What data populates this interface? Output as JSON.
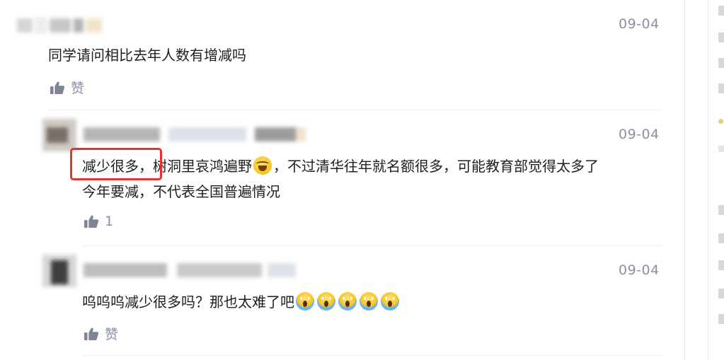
{
  "comments": [
    {
      "date": "09-04",
      "text": "同学请问相比去年人数有增减吗",
      "like_label": "赞"
    },
    {
      "date": "09-04",
      "text_highlight": "减少很多，",
      "text_line1_rest": "树洞里哀鸿遍野",
      "text_line1_tail": "，不过清华往年就名额很多，可能教育部觉得太多了",
      "text_line2": "今年要减，不代表全国普遍情况",
      "like_count": "1"
    },
    {
      "date": "09-04",
      "text": "呜呜呜减少很多吗？那也太难了吧",
      "like_label": "赞"
    }
  ],
  "icons": {
    "like": "thumbs-up-icon",
    "emoji_laugh": "laughing-tears-emoji",
    "emoji_scream": "screaming-face-emoji"
  },
  "colors": {
    "highlight_border": "#e5322d",
    "meta_gray": "#8a919f"
  }
}
